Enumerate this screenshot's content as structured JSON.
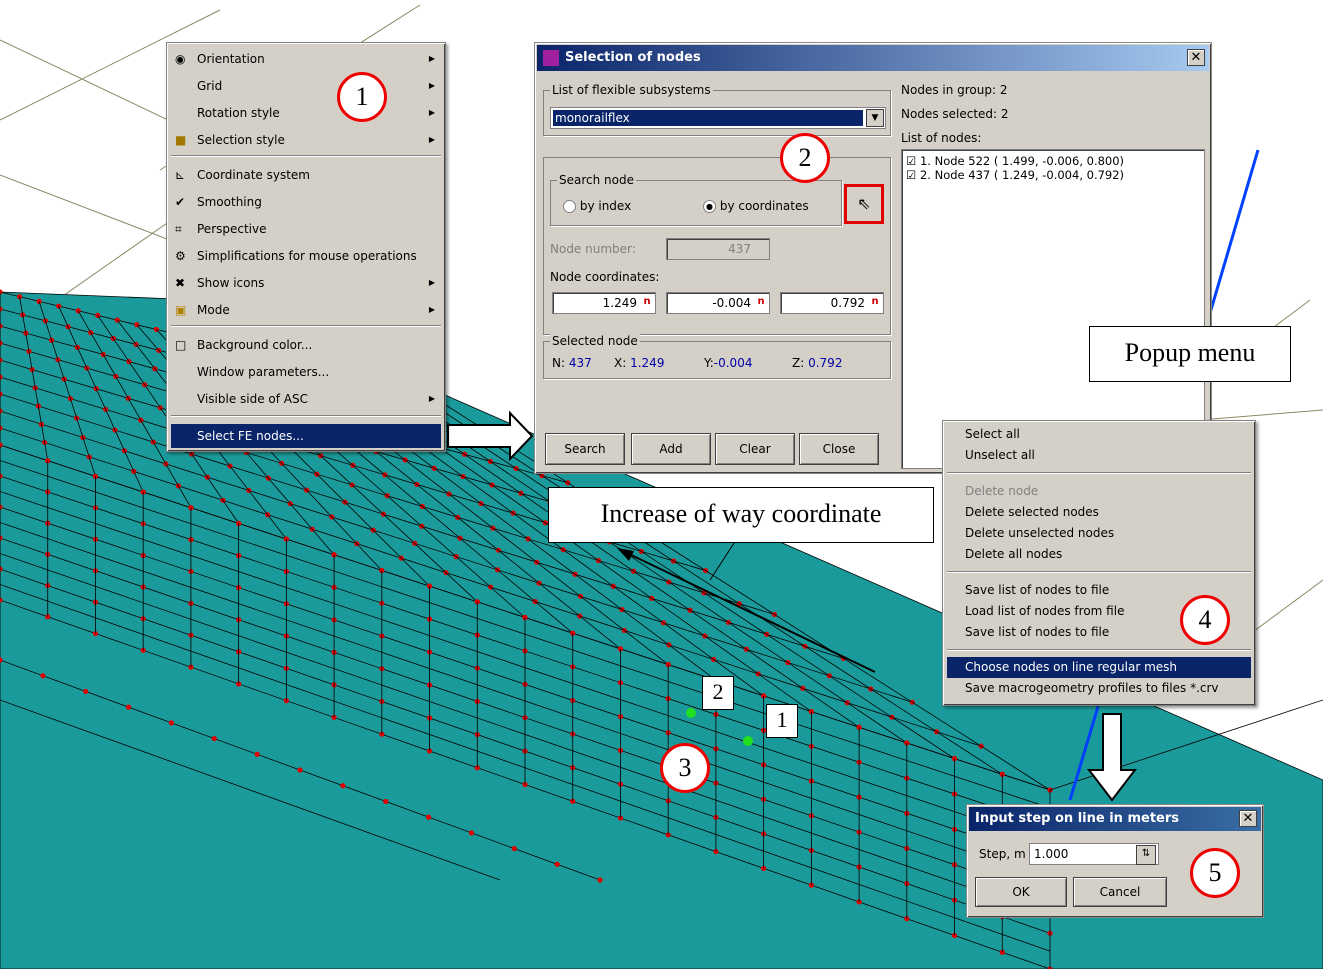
{
  "context_menu": {
    "items": [
      {
        "label": "Orientation",
        "icon": "eye-icon",
        "submenu": true
      },
      {
        "label": "Grid",
        "icon": "",
        "submenu": true
      },
      {
        "label": "Rotation style",
        "icon": "",
        "submenu": true
      },
      {
        "label": "Selection style",
        "icon": "cube-icon",
        "submenu": true
      },
      {
        "label": "Coordinate system",
        "icon": "axes-icon",
        "submenu": false
      },
      {
        "label": "Smoothing",
        "icon": "check-icon",
        "submenu": false
      },
      {
        "label": "Perspective",
        "icon": "perspective-icon",
        "submenu": false
      },
      {
        "label": "Simplifications for mouse operations",
        "icon": "mouse-icon",
        "submenu": false
      },
      {
        "label": "Show icons",
        "icon": "icons-icon",
        "submenu": true
      },
      {
        "label": "Mode",
        "icon": "mode-icon",
        "submenu": true
      },
      {
        "label": "Background color...",
        "icon": "color-box-icon",
        "submenu": false
      },
      {
        "label": "Window parameters...",
        "icon": "",
        "submenu": false
      },
      {
        "label": "Visible side of ASC",
        "icon": "",
        "submenu": true
      },
      {
        "label": "Select FE nodes...",
        "icon": "",
        "submenu": false,
        "selected": true
      }
    ]
  },
  "dialog": {
    "title": "Selection of nodes",
    "subsystems_label": "List of flexible subsystems",
    "subsystem_value": "monorailflex",
    "search_node_label": "Search node",
    "by_index_label": "by index",
    "by_coordinates_label": "by coordinates",
    "node_number_label": "Node number:",
    "node_number_value": "437",
    "node_coords_label": "Node coordinates:",
    "coord_x": "1.249",
    "coord_y": "-0.004",
    "coord_z": "0.792",
    "selected_node_label": "Selected node",
    "sel_n_label": "N:",
    "sel_n": "437",
    "sel_x_label": "X:",
    "sel_x": "1.249",
    "sel_y_label": "Y:",
    "sel_y": "-0.004",
    "sel_z_label": "Z:",
    "sel_z": "0.792",
    "nodes_in_group": "Nodes in group: 2",
    "nodes_selected": "Nodes selected: 2",
    "list_of_nodes_label": "List of nodes:",
    "nodes": [
      "1. Node 522 (  1.499, -0.006,  0.800)",
      "2. Node 437 (  1.249, -0.004,  0.792)"
    ],
    "buttons": {
      "search": "Search",
      "add": "Add",
      "clear": "Clear",
      "close": "Close"
    }
  },
  "popup_menu": {
    "items": [
      {
        "label": "Select all",
        "enabled": true
      },
      {
        "label": "Unselect all",
        "enabled": true
      },
      {
        "label": "Delete node",
        "enabled": false
      },
      {
        "label": "Delete selected nodes",
        "enabled": true
      },
      {
        "label": "Delete unselected nodes",
        "enabled": true
      },
      {
        "label": "Delete all nodes",
        "enabled": true
      },
      {
        "label": "Save list of nodes to file",
        "enabled": true
      },
      {
        "label": "Load list of nodes from file",
        "enabled": true
      },
      {
        "label": "Save list of nodes to file",
        "enabled": true
      },
      {
        "label": "Choose nodes on line regular mesh",
        "enabled": true,
        "selected": true
      },
      {
        "label": "Save macrogeometry profiles to files *.crv",
        "enabled": true
      }
    ]
  },
  "step_dialog": {
    "title": "Input step on line in meters",
    "step_label": "Step, m",
    "step_value": "1.000",
    "ok": "OK",
    "cancel": "Cancel"
  },
  "annotations": {
    "popup_menu_label": "Popup menu",
    "increase_label": "Increase of way coordinate",
    "circle_1": "1",
    "circle_2": "2",
    "circle_3": "3",
    "circle_4": "4",
    "circle_5": "5",
    "node_label_1": "1",
    "node_label_2": "2"
  },
  "colors": {
    "mesh_face": "#1a9a9a",
    "node_red": "#e00000",
    "node_green": "#20e020",
    "title_blue": "#0a246a"
  }
}
